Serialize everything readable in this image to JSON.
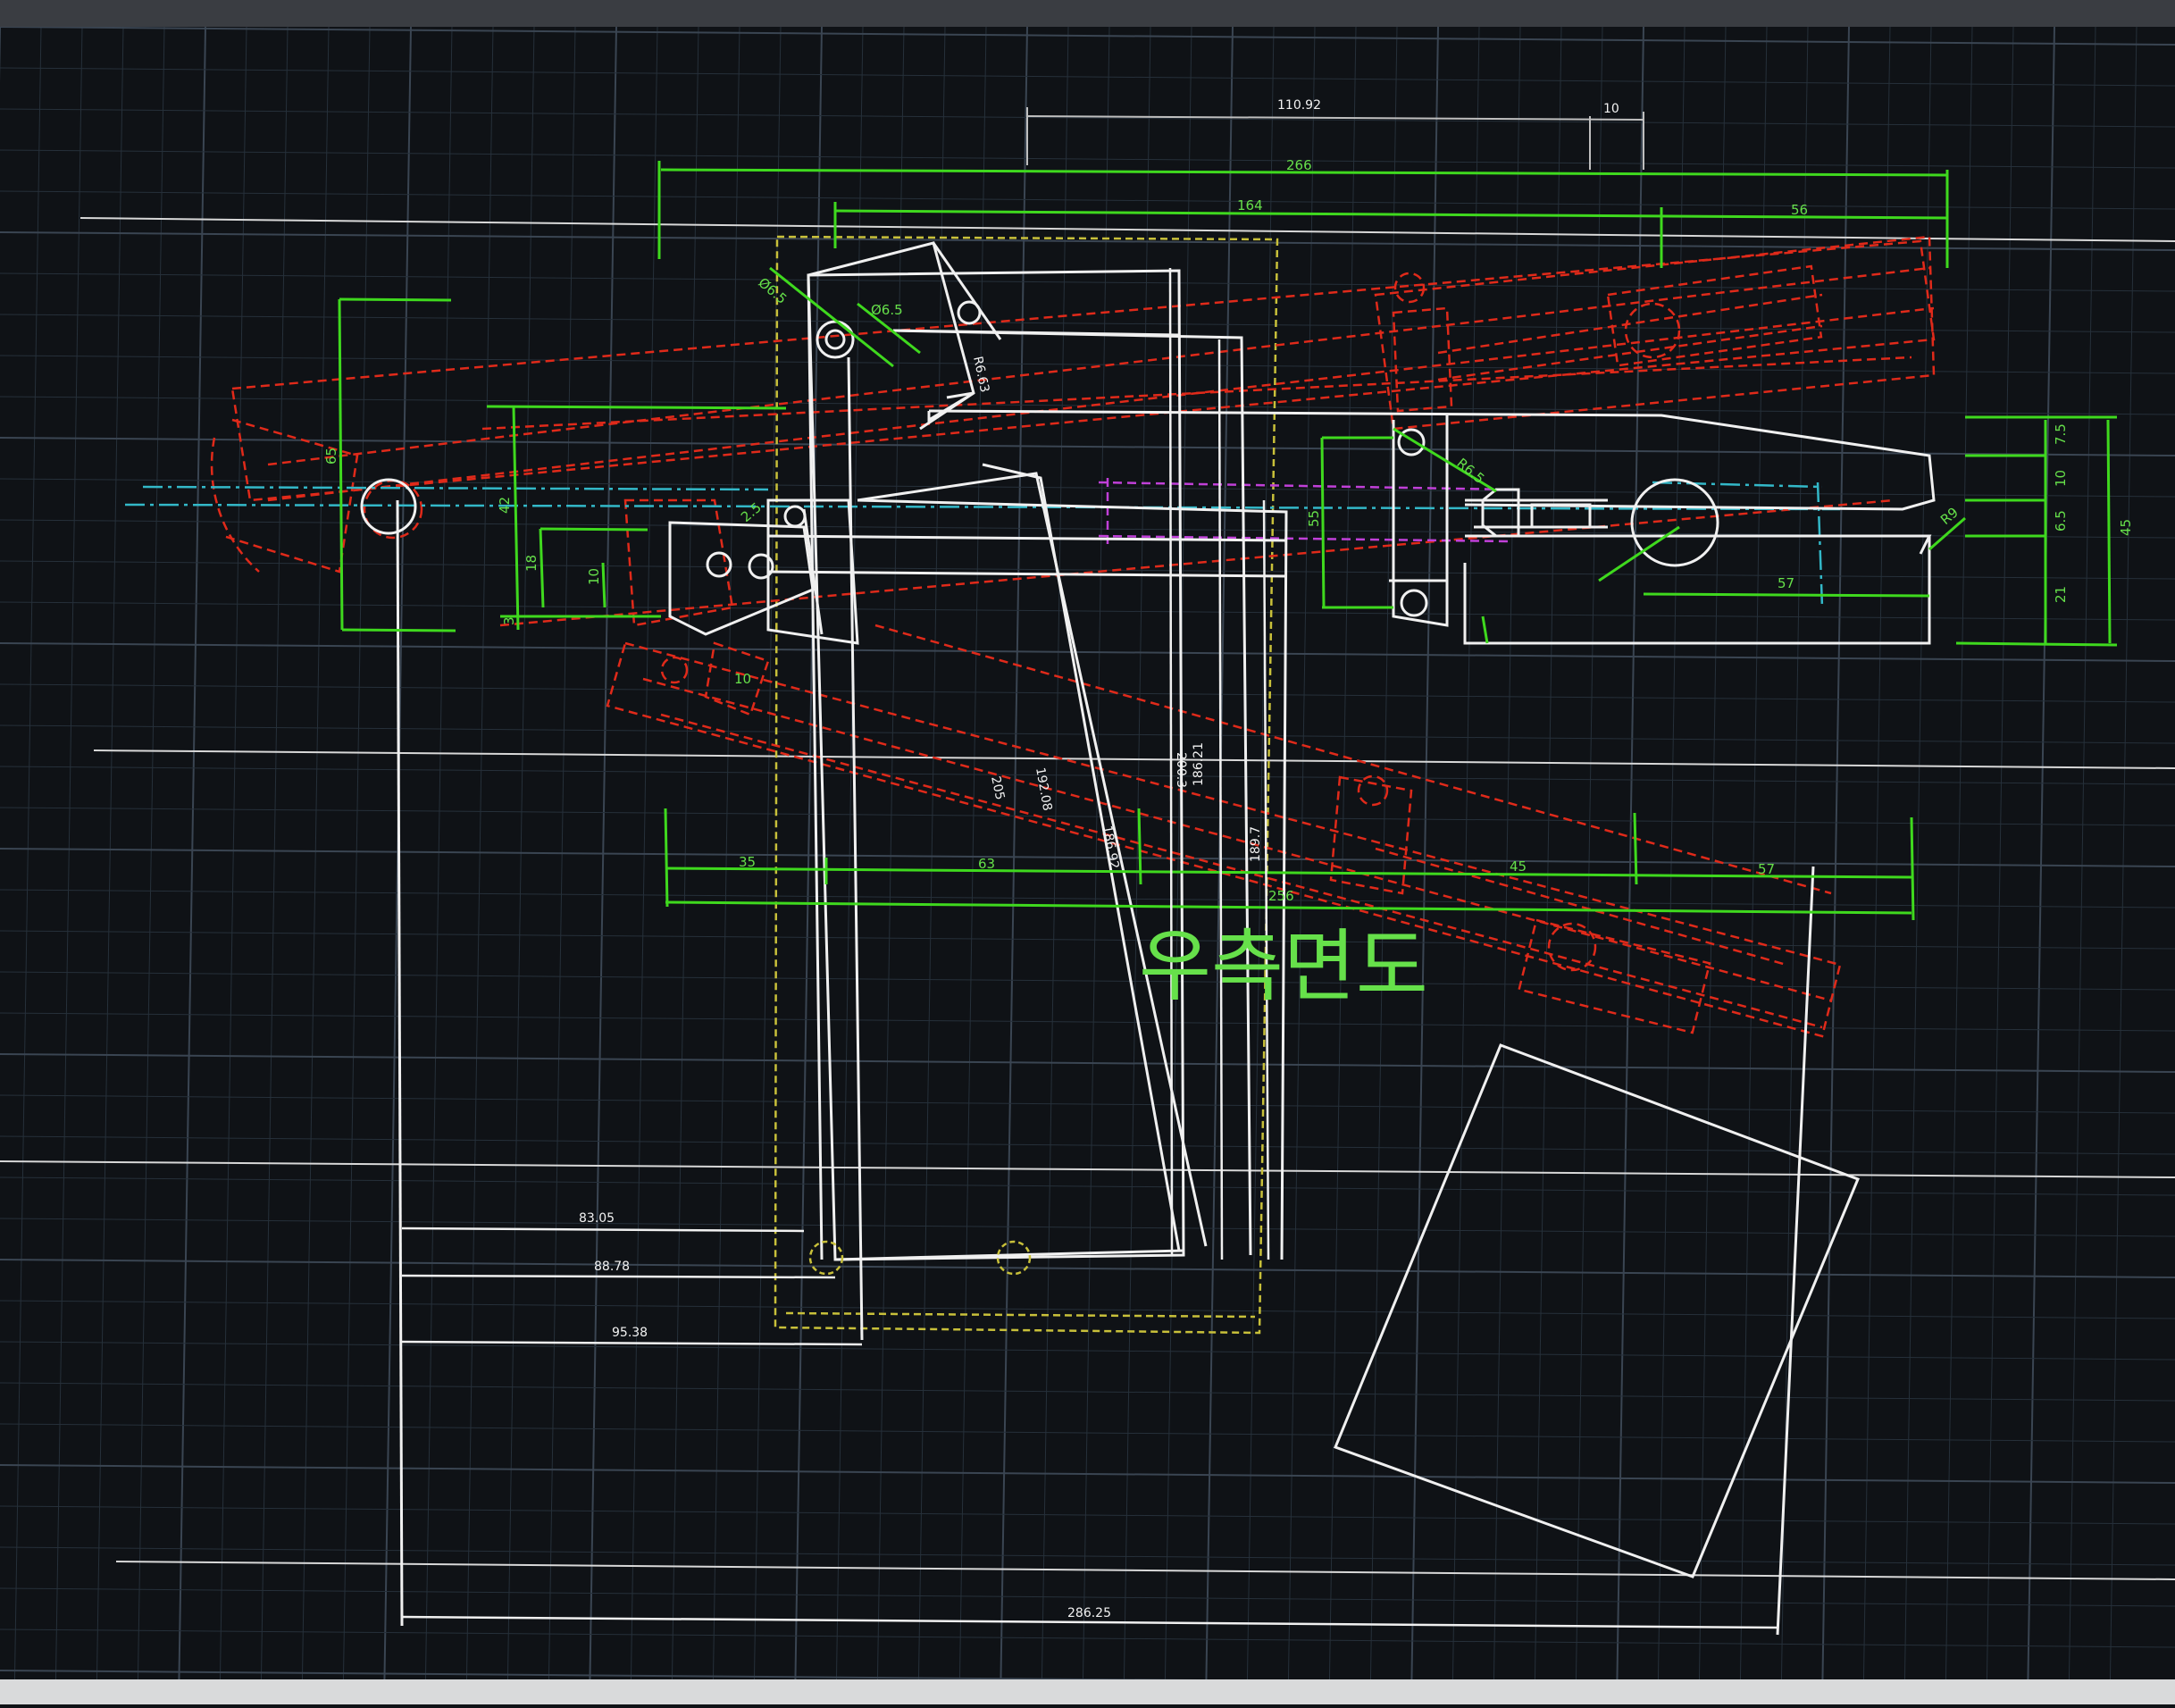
{
  "view_title": "우측면도",
  "colors": {
    "background": "#0f1216",
    "grid": "#26303a",
    "grid_major": "#3a4552",
    "dimension_green": "#3fd91e",
    "outline_white": "#f0f0f0",
    "hidden_red": "#e02a1a",
    "center_cyan": "#33b8c8",
    "construction_yellow": "#c8c03a",
    "magenta": "#c040d8"
  },
  "dimensions": {
    "top_110": "110.92",
    "top_10": "10",
    "top_266": "266",
    "top_164": "164",
    "top_56": "56",
    "dia_65": "Ø6.5",
    "dia_65b": "Ø6.5",
    "r_63": "R6.63",
    "r_65": "R6.5",
    "left_65": "65",
    "left_42": "42",
    "left_18": "18",
    "left_10": "10",
    "left_3": "3",
    "small_10": "10",
    "small_25": "2.5",
    "mid_55": "55",
    "right_57": "57",
    "right_75": "7.5",
    "right_10": "10",
    "right_65": "6.5",
    "right_21": "21",
    "right_45": "45",
    "right_r9": "R9",
    "len_205": "205",
    "len_192": "192.08",
    "len_186b": "186.92",
    "len_200": "200.3",
    "len_186": "186.21",
    "len_189": "189.7",
    "bot_35": "35",
    "bot_63": "63",
    "bot_45": "45",
    "bot_57": "57",
    "bot_256": "256",
    "w_83": "83.05",
    "w_88": "88.78",
    "w_95": "95.38",
    "w_286": "286.25"
  }
}
